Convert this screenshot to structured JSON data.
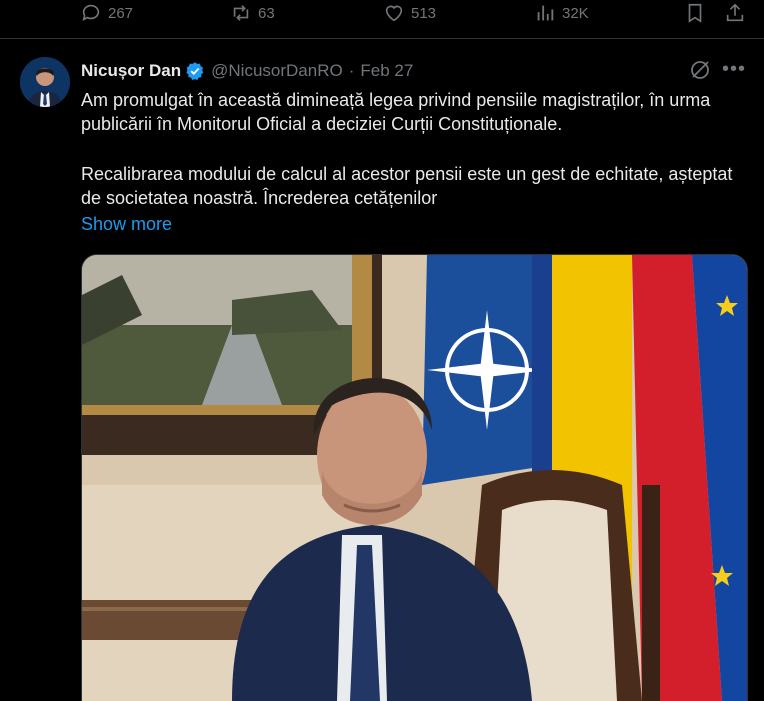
{
  "previous_post": {
    "reply_count": "267",
    "repost_count": "63",
    "like_count": "513",
    "view_count": "32K"
  },
  "post": {
    "author_name": "Nicușor Dan",
    "handle": "@NicusorDanRO",
    "separator": "·",
    "date": "Feb 27",
    "paragraph_1": "Am promulgat în această dimineață legea privind pensiile magistraților, în urma publicării în Monitorul Oficial a deciziei Curții Constituționale.",
    "paragraph_2": "Recalibrarea modului de calcul al acestor pensii este un gest de echitate, așteptat de societatea noastră. Încrederea cetățenilor",
    "show_more": "Show more"
  },
  "icons": {
    "reply": "reply-icon",
    "repost": "repost-icon",
    "like": "heart-icon",
    "views": "analytics-icon",
    "bookmark": "bookmark-icon",
    "share": "share-icon",
    "verified": "verified-badge-icon",
    "grok": "grok-icon",
    "more": "more-icon"
  },
  "colors": {
    "background": "#000000",
    "text": "#e7e9ea",
    "secondary": "#71767b",
    "accent": "#1d9bf0"
  }
}
